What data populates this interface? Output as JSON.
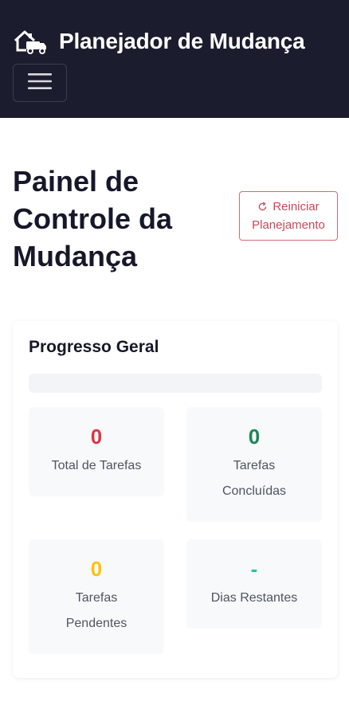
{
  "navbar": {
    "brand_icon": "moving-truck-house-icon",
    "brand_title": "Planejador de Mudança",
    "menu_icon": "hamburger-menu-icon"
  },
  "header": {
    "title": "Painel de Controle da Mudança",
    "reset_button": {
      "icon": "refresh-icon",
      "label_line1": "Reiniciar",
      "label_line2": "Planejamento"
    }
  },
  "progress_card": {
    "title": "Progresso Geral",
    "progress_percent": 0,
    "stats": [
      {
        "value": "0",
        "label": "Total de Tarefas",
        "color": "#dc3545"
      },
      {
        "value": "0",
        "label": "Tarefas Concluídas",
        "color": "#198754"
      },
      {
        "value": "0",
        "label": "Tarefas Pendentes",
        "color": "#ffc107"
      },
      {
        "value": "-",
        "label": "Dias Restantes",
        "color": "#20c997"
      }
    ]
  },
  "colors": {
    "navbar_bg": "#1b1c2e",
    "danger": "#dc3545",
    "success": "#198754",
    "warning": "#ffc107",
    "info": "#20c997"
  }
}
